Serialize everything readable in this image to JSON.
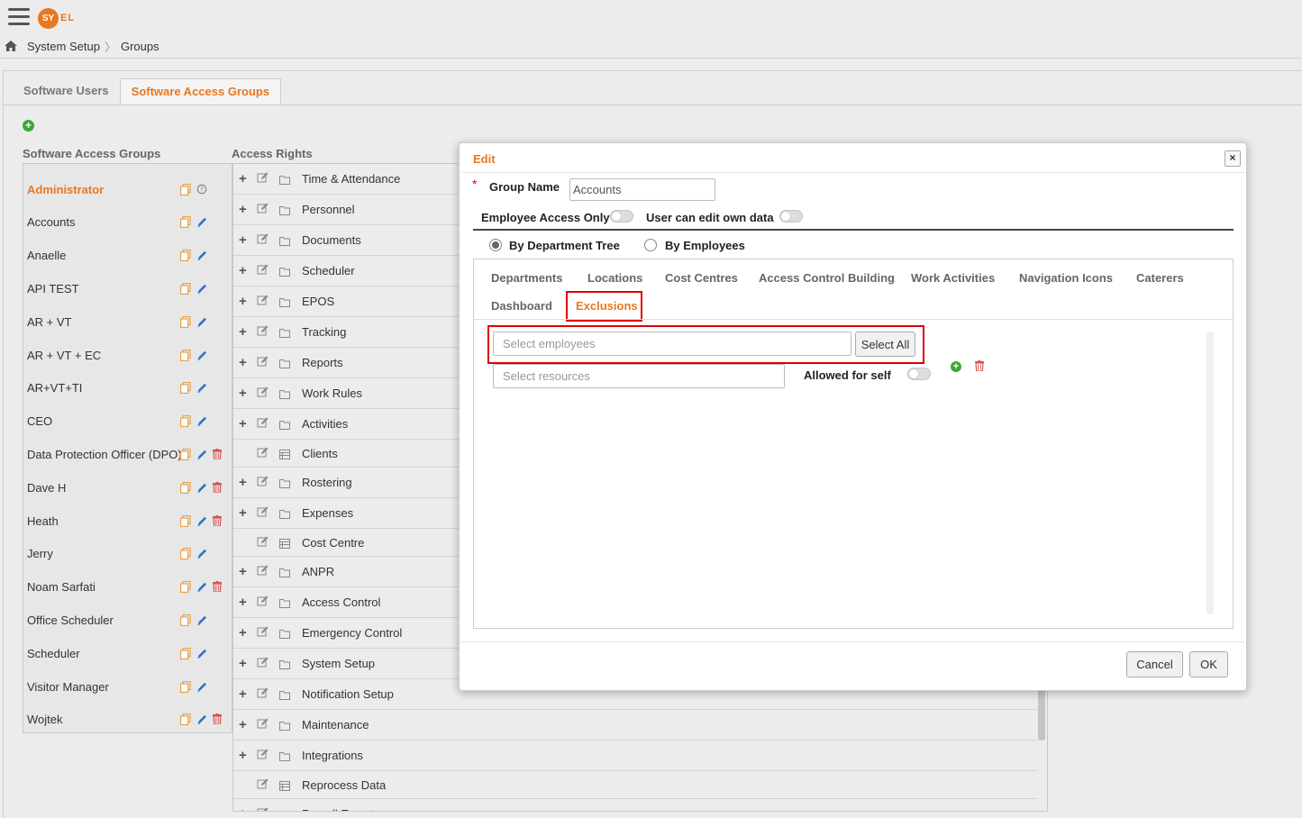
{
  "app": {
    "logo_prefix": "SY",
    "logo_suffix": "EL"
  },
  "breadcrumb": {
    "items": [
      "System Setup",
      "Groups"
    ]
  },
  "tabs": [
    {
      "label": "Software Users",
      "active": false
    },
    {
      "label": "Software Access Groups",
      "active": true
    }
  ],
  "groups_panel": {
    "title": "Software Access Groups",
    "items": [
      {
        "name": "Administrator",
        "admin": true,
        "deletable": false
      },
      {
        "name": "Accounts",
        "deletable": false
      },
      {
        "name": "Anaelle",
        "deletable": false
      },
      {
        "name": "API TEST",
        "deletable": false
      },
      {
        "name": "AR + VT",
        "deletable": false
      },
      {
        "name": "AR + VT + EC",
        "deletable": false
      },
      {
        "name": "AR+VT+TI",
        "deletable": false
      },
      {
        "name": "CEO",
        "deletable": false
      },
      {
        "name": "Data Protection Officer (DPO)",
        "deletable": true
      },
      {
        "name": "Dave H",
        "deletable": true
      },
      {
        "name": "Heath",
        "deletable": true
      },
      {
        "name": "Jerry",
        "deletable": false
      },
      {
        "name": "Noam Sarfati",
        "deletable": true
      },
      {
        "name": "Office Scheduler",
        "deletable": false
      },
      {
        "name": "Scheduler",
        "deletable": false
      },
      {
        "name": "Visitor Manager",
        "deletable": false
      },
      {
        "name": "Wojtek",
        "deletable": true
      }
    ]
  },
  "rights_panel": {
    "title": "Access Rights",
    "items": [
      {
        "label": "Time & Attendance",
        "expandable": true,
        "kind": "folder"
      },
      {
        "label": "Personnel",
        "expandable": true,
        "kind": "folder"
      },
      {
        "label": "Documents",
        "expandable": true,
        "kind": "folder"
      },
      {
        "label": "Scheduler",
        "expandable": true,
        "kind": "folder"
      },
      {
        "label": "EPOS",
        "expandable": true,
        "kind": "folder"
      },
      {
        "label": "Tracking",
        "expandable": true,
        "kind": "folder"
      },
      {
        "label": "Reports",
        "expandable": true,
        "kind": "folder"
      },
      {
        "label": "Work Rules",
        "expandable": true,
        "kind": "folder"
      },
      {
        "label": "Activities",
        "expandable": true,
        "kind": "folder"
      },
      {
        "label": "Clients",
        "expandable": false,
        "kind": "grid"
      },
      {
        "label": "Rostering",
        "expandable": true,
        "kind": "folder"
      },
      {
        "label": "Expenses",
        "expandable": true,
        "kind": "folder"
      },
      {
        "label": "Cost Centre",
        "expandable": false,
        "kind": "grid"
      },
      {
        "label": "ANPR",
        "expandable": true,
        "kind": "folder"
      },
      {
        "label": "Access Control",
        "expandable": true,
        "kind": "folder"
      },
      {
        "label": "Emergency Control",
        "expandable": true,
        "kind": "folder"
      },
      {
        "label": "System Setup",
        "expandable": true,
        "kind": "folder"
      },
      {
        "label": "Notification Setup",
        "expandable": true,
        "kind": "folder"
      },
      {
        "label": "Maintenance",
        "expandable": true,
        "kind": "folder"
      },
      {
        "label": "Integrations",
        "expandable": true,
        "kind": "folder"
      },
      {
        "label": "Reprocess Data",
        "expandable": false,
        "kind": "grid"
      },
      {
        "label": "Payroll Export",
        "expandable": true,
        "kind": "folder"
      }
    ]
  },
  "dialog": {
    "title": "Edit",
    "close_glyph": "×",
    "required_mark": "*",
    "group_name_label": "Group Name",
    "group_name_value": "Accounts",
    "employee_access_only_label": "Employee Access Only",
    "employee_access_only": false,
    "user_can_edit_label": "User can edit own data",
    "user_can_edit": false,
    "radio_dept_label": "By Department Tree",
    "radio_emp_label": "By Employees",
    "selected_mode": "By Department Tree",
    "inner_tabs": [
      {
        "label": "Departments"
      },
      {
        "label": "Locations"
      },
      {
        "label": "Cost Centres"
      },
      {
        "label": "Access Control Building"
      },
      {
        "label": "Work Activities"
      },
      {
        "label": "Navigation Icons"
      },
      {
        "label": "Caterers"
      },
      {
        "label": "Dashboard"
      },
      {
        "label": "Exclusions",
        "active": true
      }
    ],
    "select_employees_placeholder": "Select employees",
    "select_all_label": "Select All",
    "select_resources_placeholder": "Select resources",
    "allowed_for_self_label": "Allowed for self",
    "allowed_for_self": false,
    "cancel_label": "Cancel",
    "ok_label": "OK"
  },
  "colors": {
    "accent": "#e87722",
    "add_green": "#3aa935",
    "delete_red": "#d9534f",
    "highlight_red": "#dd0000",
    "edit_blue": "#2f6fcf"
  }
}
